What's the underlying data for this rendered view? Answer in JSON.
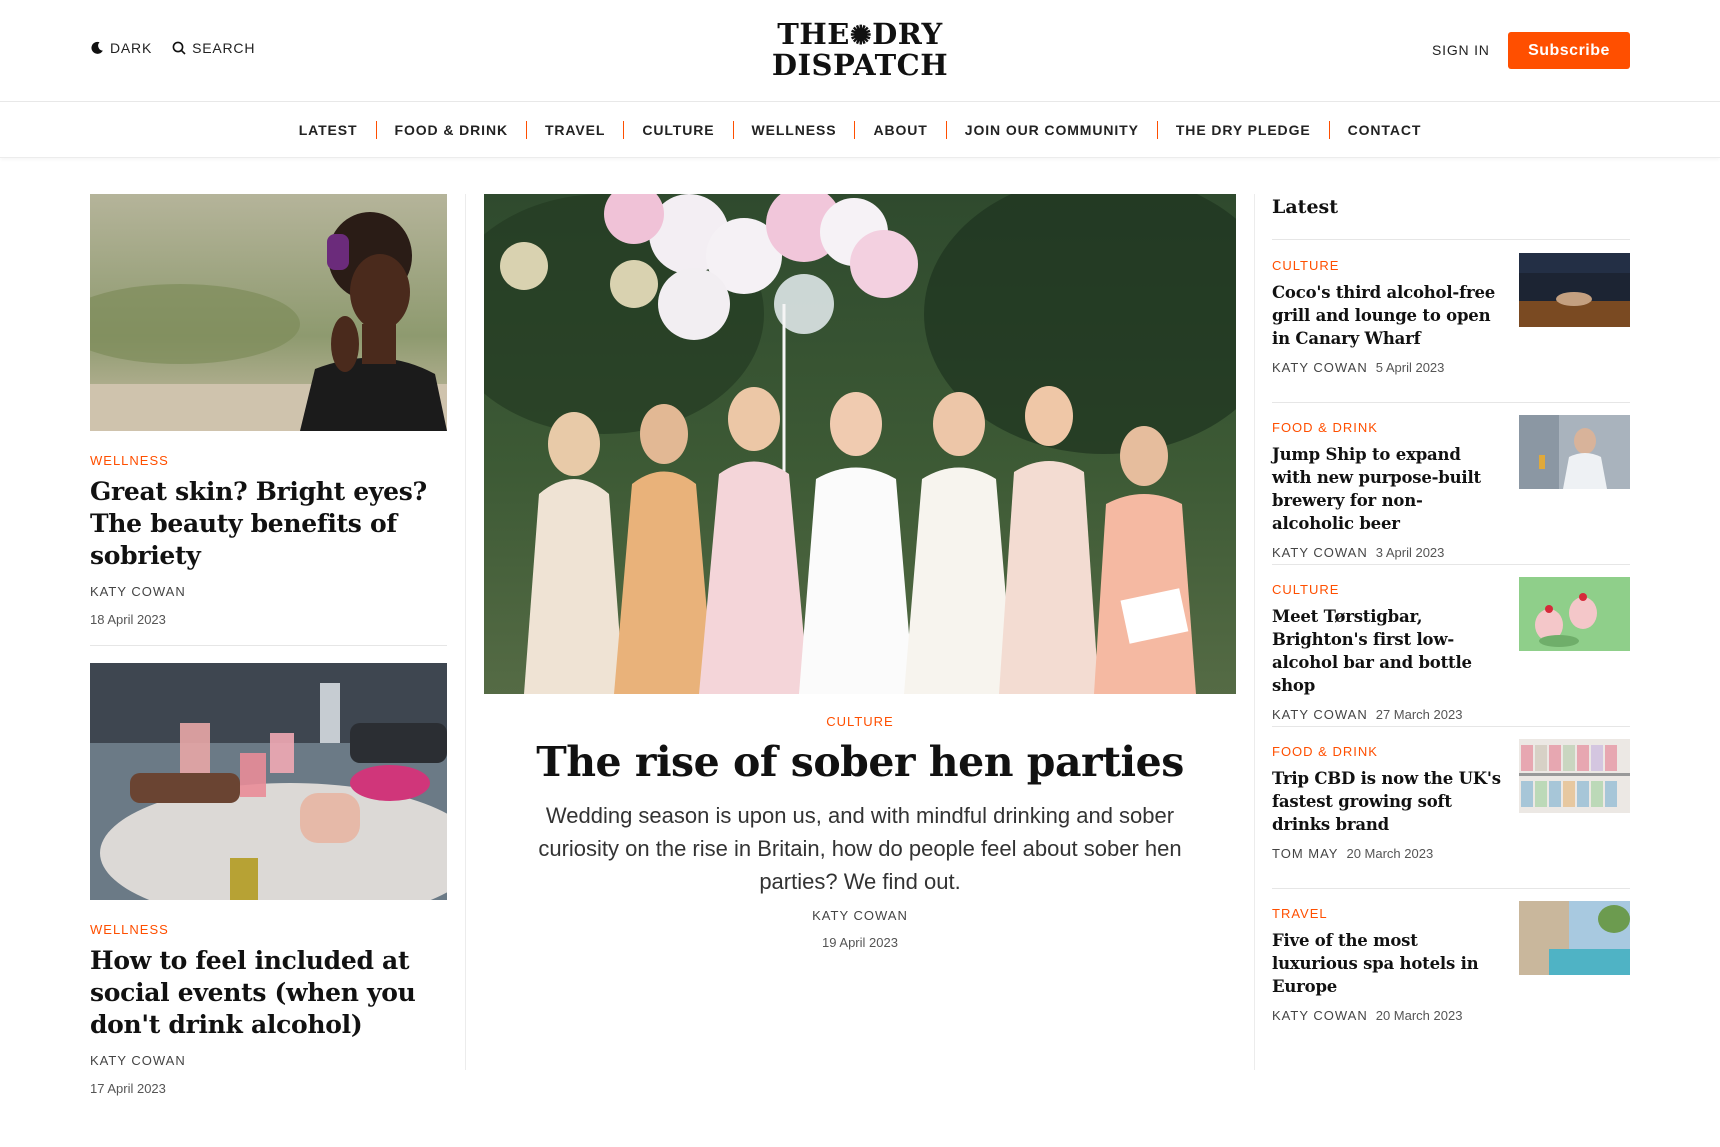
{
  "header": {
    "dark_label": "DARK",
    "search_label": "SEARCH",
    "logo_line1_a": "THE",
    "logo_line1_b": "DRY",
    "logo_line2": "DISPATCH",
    "signin_label": "SIGN IN",
    "subscribe_label": "Subscribe"
  },
  "nav": {
    "items": [
      "LATEST",
      "FOOD & DRINK",
      "TRAVEL",
      "CULTURE",
      "WELLNESS",
      "ABOUT",
      "JOIN OUR COMMUNITY",
      "THE DRY PLEDGE",
      "CONTACT"
    ]
  },
  "left_articles": [
    {
      "category": "WELLNESS",
      "headline": "Great skin? Bright eyes? The beauty benefits of sobriety",
      "author": "KATY COWAN",
      "date": "18 April 2023"
    },
    {
      "category": "WELLNESS",
      "headline": "How to feel included at social events (when you don't drink alcohol)",
      "author": "KATY COWAN",
      "date": "17 April 2023"
    }
  ],
  "featured": {
    "category": "CULTURE",
    "headline": "The rise of sober hen parties",
    "dek": "Wedding season is upon us, and with mindful drinking and sober curiosity on the rise in Britain, how do people feel about sober hen parties? We find out.",
    "author": "KATY COWAN",
    "date": "19 April 2023"
  },
  "latest": {
    "title": "Latest",
    "items": [
      {
        "category": "CULTURE",
        "headline": "Coco's third alcohol-free grill and lounge to open in Canary Wharf",
        "author": "KATY COWAN",
        "date": "5 April 2023"
      },
      {
        "category": "FOOD & DRINK",
        "headline": "Jump Ship to expand with new purpose-built brewery for non-alcoholic beer",
        "author": "KATY COWAN",
        "date": "3 April 2023"
      },
      {
        "category": "CULTURE",
        "headline": "Meet Tørstigbar, Brighton's first low-alcohol bar and bottle shop",
        "author": "KATY COWAN",
        "date": "27 March 2023"
      },
      {
        "category": "FOOD & DRINK",
        "headline": "Trip CBD is now the UK's fastest growing soft drinks brand",
        "author": "TOM MAY",
        "date": "20 March 2023"
      },
      {
        "category": "TRAVEL",
        "headline": "Five of the most luxurious spa hotels in Europe",
        "author": "KATY COWAN",
        "date": "20 March 2023"
      }
    ]
  },
  "colors": {
    "accent": "#ff4f00",
    "text": "#111111",
    "divider": "#ececec"
  }
}
